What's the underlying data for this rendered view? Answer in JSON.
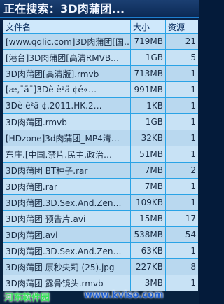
{
  "search": {
    "title": "正在搜索：3D肉蒲团..."
  },
  "columns": {
    "name": "文件名",
    "size": "大小",
    "source": "资源"
  },
  "rows": [
    {
      "name": "[www.qqlic.com]3D肉蒲团[国…",
      "size": "719MB",
      "source": "21"
    },
    {
      "name": "[港台]3D肉蒲团[高清RMVB…",
      "size": "1GB",
      "source": "5"
    },
    {
      "name": "3D肉蒲团[高清版].rmvb",
      "size": "713MB",
      "source": "1"
    },
    {
      "name": "[æ,¯ã¯]3Dè è²ä ¢é«…",
      "size": "991MB",
      "source": "1"
    },
    {
      "name": "3Dè è²ä ¢.2011.HK.2…",
      "size": "1KB",
      "source": "1"
    },
    {
      "name": "3D肉蒲团.rmvb",
      "size": "1GB",
      "source": "1"
    },
    {
      "name": "[HDzone]3d肉蒲团_MP4清…",
      "size": "32KB",
      "source": "1"
    },
    {
      "name": "东庄.[中国.禁片.民主.政治…",
      "size": "51MB",
      "source": "1"
    },
    {
      "name": "3D肉蒲团 BT种子.rar",
      "size": "7MB",
      "source": "2"
    },
    {
      "name": "3D肉蒲团.rar",
      "size": "7MB",
      "source": "1"
    },
    {
      "name": "3D肉蒲团.3D.Sex.And.Zen…",
      "size": "109KB",
      "source": "1"
    },
    {
      "name": "3D肉蒲团 预告片.avi",
      "size": "15MB",
      "source": "17"
    },
    {
      "name": "3D肉蒲团.avi",
      "size": "538MB",
      "source": "54"
    },
    {
      "name": "3D肉蒲团.3D.Sex.And.Zen…",
      "size": "63KB",
      "source": "1"
    },
    {
      "name": "3D肉蒲团 原秒央莉 (25).jpg",
      "size": "227KB",
      "source": "8"
    },
    {
      "name": "3D肉蒲团 露骨镜头.rmvb",
      "size": "3MB",
      "source": "1"
    }
  ],
  "watermark": {
    "cn": "河东软件园",
    "en": "www.kviso.com"
  }
}
